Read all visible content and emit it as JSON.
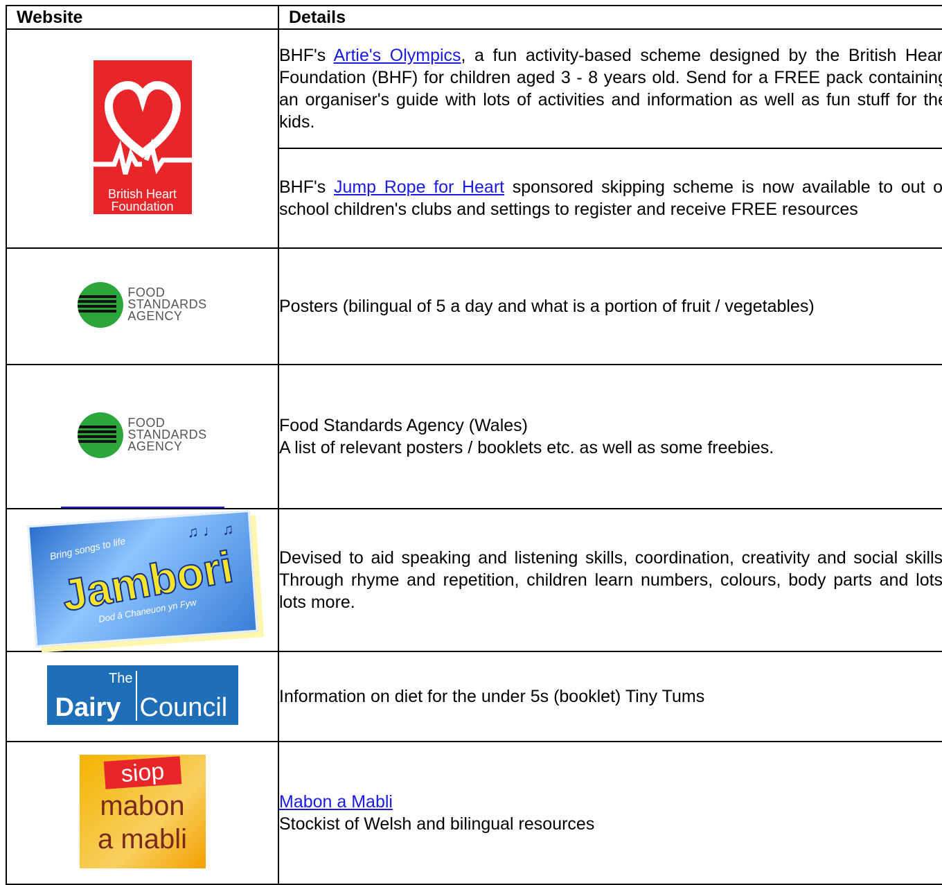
{
  "table": {
    "header": {
      "website": "Website",
      "details": "Details"
    },
    "bhf": {
      "logo_text_1": "British Heart",
      "logo_text_2": "Foundation",
      "artie": {
        "prefix": "BHF's ",
        "link": "Artie's Olympics",
        "text": ", a fun activity-based scheme designed by the British Heart Foundation (BHF) for children aged 3 - 8 years old. Send for a FREE pack containing an organiser's guide with lots of activities and information as well as fun stuff for the kids."
      },
      "jump": {
        "prefix": "BHF's ",
        "link": "Jump Rope for Heart",
        "text": " sponsored skipping scheme is now available to out of school children's clubs and settings to register and receive FREE resources"
      }
    },
    "fsa_logo": {
      "line1": "FOOD",
      "line2": "STANDARDS",
      "line3": "AGENCY"
    },
    "fsa1": {
      "text": "Posters (bilingual of 5 a day and what is a portion of fruit / vegetables)"
    },
    "fsa2": {
      "line1": "Food Standards Agency (Wales)",
      "line2": "A list of relevant posters / booklets etc. as well as some freebies."
    },
    "jambori": {
      "logo_small": "Bring songs to life",
      "logo_big": "Jambori",
      "logo_sub": "Dod â Chaneuon yn Fyw",
      "text": "Devised to aid speaking and listening skills, coordination, creativity and social skills. Through rhyme and repetition, children learn numbers, colours, body parts and lots, lots more."
    },
    "dairy": {
      "logo_the": "The",
      "logo_dairy": "Dairy",
      "logo_council": "Council",
      "text": "Information on diet for the under 5s (booklet) Tiny Tums"
    },
    "mabon": {
      "logo_siop": "siop",
      "logo_line1": "mabon",
      "logo_line2": "a mabli",
      "link": "Mabon a Mabli",
      "text": "Stockist of Welsh and bilingual resources"
    }
  }
}
